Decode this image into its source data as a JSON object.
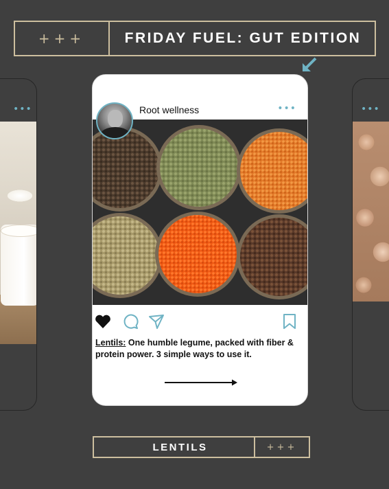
{
  "banner": {
    "stars": "+++",
    "title": "FRIDAY FUEL: GUT EDITION"
  },
  "post": {
    "username": "Root wellness",
    "more": "•••",
    "caption_keyword": "Lentils:",
    "caption_text": " One humble legume, packed with fiber & protein power. 3 simple ways to use it.",
    "actions": [
      "heart-icon",
      "comment-icon",
      "share-icon",
      "bookmark-icon"
    ],
    "liked": true
  },
  "side_cards": {
    "left_more": "•••",
    "right_more": "•••"
  },
  "bottom_tag": {
    "label": "LENTILS",
    "stars": "+++"
  },
  "colors": {
    "background": "#3f3f3f",
    "gold": "#cdbf9f",
    "accent_teal": "#6fb3c4",
    "card": "#ffffff"
  }
}
